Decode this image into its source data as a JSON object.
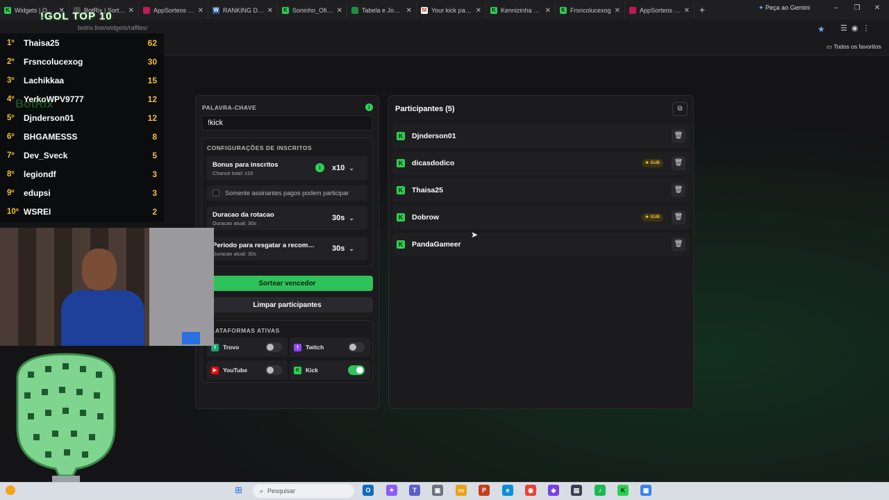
{
  "browser": {
    "tabs": [
      {
        "label": "Widgets | O...",
        "favicon": "kick-icon",
        "color": "#2ecf4f"
      },
      {
        "label": "BotRix | Sorte...",
        "favicon": "botrix-icon",
        "color": "#4a4a4a"
      },
      {
        "label": "AppSorteos – F...",
        "favicon": "appsorteos-icon",
        "color": "#c2185b"
      },
      {
        "label": "RANKING DE F...",
        "favicon": "word-icon",
        "color": "#2b579a"
      },
      {
        "label": "Soninho_Oficia...",
        "favicon": "kick-icon",
        "color": "#2ecf4f"
      },
      {
        "label": "Tabela e Jogos...",
        "favicon": "sheets-icon",
        "color": "#1e8e3e"
      },
      {
        "label": "Your kick paym...",
        "favicon": "gmail-icon",
        "color": "#d93025"
      },
      {
        "label": "Kennizinha Str...",
        "favicon": "kick-icon",
        "color": "#2ecf4f"
      },
      {
        "label": "Frsncolucexog",
        "favicon": "kick-icon",
        "color": "#2ecf4f"
      },
      {
        "label": "AppSorteos – F...",
        "favicon": "appsorteos-icon",
        "color": "#c2185b"
      }
    ],
    "gemini": "Peça ao Gemini",
    "url": "botrix.live/widgets/raffles/",
    "favorites": "Todos os favoritos"
  },
  "leaderboard": {
    "title": "!GOL TOP 10",
    "watermark": "BotRix",
    "rows": [
      {
        "rank": "1º",
        "name": "Thaisa25",
        "points": "62"
      },
      {
        "rank": "2º",
        "name": "Frsncolucexog",
        "points": "30"
      },
      {
        "rank": "3º",
        "name": "Lachikkaa",
        "points": "15"
      },
      {
        "rank": "4º",
        "name": "YerkoWPV9777",
        "points": "12"
      },
      {
        "rank": "5º",
        "name": "Djnderson01",
        "points": "12"
      },
      {
        "rank": "6º",
        "name": "BHGAMESSS",
        "points": "8"
      },
      {
        "rank": "7º",
        "name": "Dev_Sveck",
        "points": "5"
      },
      {
        "rank": "8º",
        "name": "legiondf",
        "points": "3"
      },
      {
        "rank": "9º",
        "name": "edupsi",
        "points": "3"
      },
      {
        "rank": "10º",
        "name": "WSREI",
        "points": "2"
      }
    ]
  },
  "raffle": {
    "keyword_label": "PALAVRA-CHAVE",
    "keyword_value": "!kick",
    "subs_section": "CONFIGURAÇÕES DE INSCRITOS",
    "bonus_title": "Bonus para inscritos",
    "bonus_sub": "Chance total: x10",
    "bonus_value": "x10",
    "paid_only": "Somente assinantes pagos podem participar",
    "rotation_title": "Duracao da rotacao",
    "rotation_sub": "Duracao atual: 30s",
    "rotation_value": "30s",
    "claim_title": "Periodo para resgatar a recomp...",
    "claim_sub": "Duracao atual: 30s",
    "claim_value": "30s",
    "draw_button": "Sortear vencedor",
    "clear_button": "Limpar participantes",
    "platforms_label": "PLATAFORMAS ATIVAS",
    "platforms": [
      {
        "name": "Trovo",
        "icon": "trovo-icon",
        "color": "#19a974",
        "enabled": false
      },
      {
        "name": "Twitch",
        "icon": "twitch-icon",
        "color": "#9146ff",
        "enabled": false
      },
      {
        "name": "YouTube",
        "icon": "youtube-icon",
        "color": "#ff0000",
        "enabled": false
      },
      {
        "name": "Kick",
        "icon": "kick-icon",
        "color": "#2ecf4f",
        "enabled": true
      }
    ]
  },
  "participants": {
    "title": "Participantes (5)",
    "list": [
      {
        "name": "Djnderson01",
        "sub": false
      },
      {
        "name": "dicasdodico",
        "sub": true
      },
      {
        "name": "Thaisa25",
        "sub": false
      },
      {
        "name": "Dobrow",
        "sub": true
      },
      {
        "name": "PandaGameer",
        "sub": false
      }
    ],
    "sub_label": "SUB"
  },
  "taskbar": {
    "search_placeholder": "Pesquisar"
  },
  "colors": {
    "accent": "#2ec25b",
    "kick": "#2ecf4f",
    "gold": "#f1c232"
  }
}
